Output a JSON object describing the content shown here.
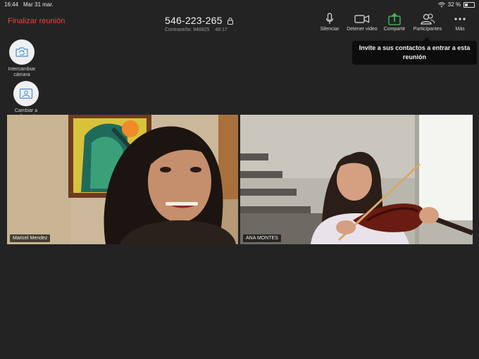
{
  "status": {
    "time": "16:44",
    "date": "Mar 31 mar.",
    "battery": "32 %"
  },
  "header": {
    "end_label": "Finalizar reunión",
    "meeting_id": "546-223-265",
    "password_label": "Contraseña: 948825",
    "duration": "48:17"
  },
  "toolbar": {
    "mute": "Silenciar",
    "stop_video": "Detener video",
    "share": "Compartir",
    "participants": "Participantes",
    "more": "Más"
  },
  "tooltip": {
    "text": "Invite a sus contactos a entrar a esta reunión"
  },
  "side": {
    "switch_camera": "Intercambiar cámara",
    "switch_speaker": "Cambiar a orador activo"
  },
  "participants": [
    {
      "name": "Maricel Mendez"
    },
    {
      "name": "ANA MONTES"
    }
  ],
  "colors": {
    "end": "#e8453c",
    "share": "#45c45a",
    "active_border": "#8edb3a"
  }
}
